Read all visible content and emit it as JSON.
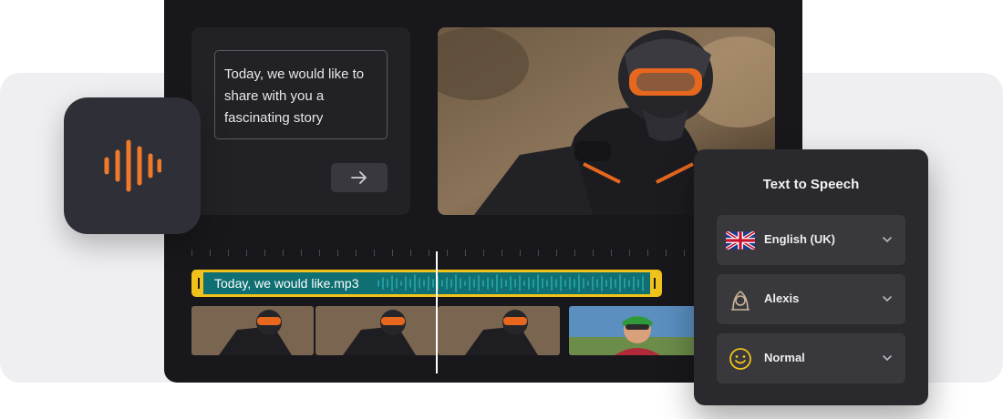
{
  "script": {
    "text": "Today, we would like to share with you a fascinating story",
    "submit_icon": "arrow-right-icon"
  },
  "timeline": {
    "audio_clip_name": "Today, we would like.mp3"
  },
  "app_icon": "sound-wave-icon",
  "tts": {
    "title": "Text to Speech",
    "language": "English (UK)",
    "voice": "Alexis",
    "style": "Normal"
  },
  "colors": {
    "accent": "#f07a2a",
    "clip": "#0f6f73",
    "clip_border": "#f1c21b"
  }
}
